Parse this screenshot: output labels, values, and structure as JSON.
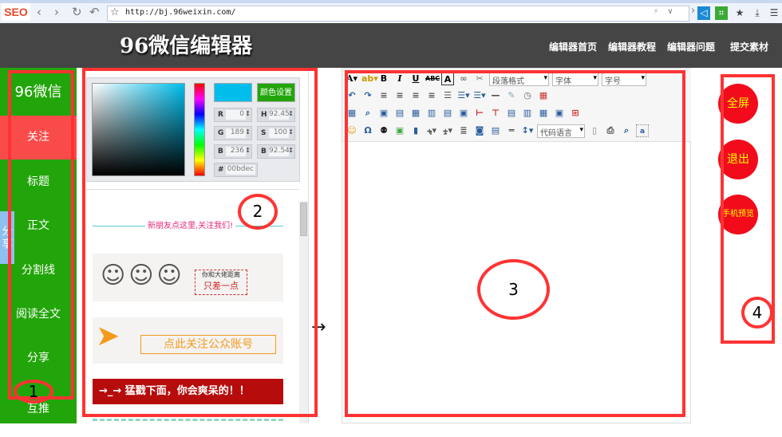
{
  "browser": {
    "badge": "SEO",
    "url": "http://bj.96weixin.com/",
    "icons": [
      "back-icon",
      "forward-icon",
      "refresh-icon",
      "undo-icon",
      "star-icon",
      "lightning-icon",
      "dropdown-icon",
      "chevron-right-icon",
      "speaker-icon",
      "crop-icon",
      "bookmark-icon",
      "download-icon",
      "menu-icon"
    ]
  },
  "header": {
    "logo": "96微信编辑器",
    "nav": [
      "编辑器首页",
      "编辑器教程",
      "编辑器问题",
      "提交素材"
    ]
  },
  "sidebar": {
    "brand": "96微信",
    "items": [
      {
        "label": "关注",
        "active": true
      },
      {
        "label": "标题"
      },
      {
        "label": "正文"
      },
      {
        "label": "分割线"
      },
      {
        "label": "阅读全文"
      },
      {
        "label": "分享"
      },
      {
        "label": "互推"
      }
    ],
    "share_tab": "分享"
  },
  "color_picker": {
    "color": "#00bdec",
    "button": "颜色设置",
    "fields": {
      "R": "0",
      "G": "189",
      "B": "236",
      "H": "92.457",
      "S": "100",
      "Br": "92.5490",
      "hex": "00bdec"
    },
    "labels": {
      "R": "R",
      "G": "G",
      "B": "B",
      "H": "H",
      "S": "S",
      "Br": "B",
      "hex": "#"
    }
  },
  "gallery": [
    "新朋友点这里,关注我们!",
    "你和大佬距离",
    "只差一点",
    "点此关注公众账号",
    "→_→ 猛戳下面，你会爽呆的！！"
  ],
  "editor": {
    "selects": {
      "paragraph": "段落格式",
      "font": "字体",
      "size": "字号",
      "code": "代码语言"
    }
  },
  "actions": [
    "全屏",
    "退出",
    "手机预览"
  ],
  "annotations": [
    "1",
    "2",
    "3",
    "4"
  ],
  "arrow": "→",
  "colors": {
    "green": "#22a50a",
    "red_annotation": "#ff3333",
    "button_red": "#f20c1b",
    "header": "#454545"
  }
}
